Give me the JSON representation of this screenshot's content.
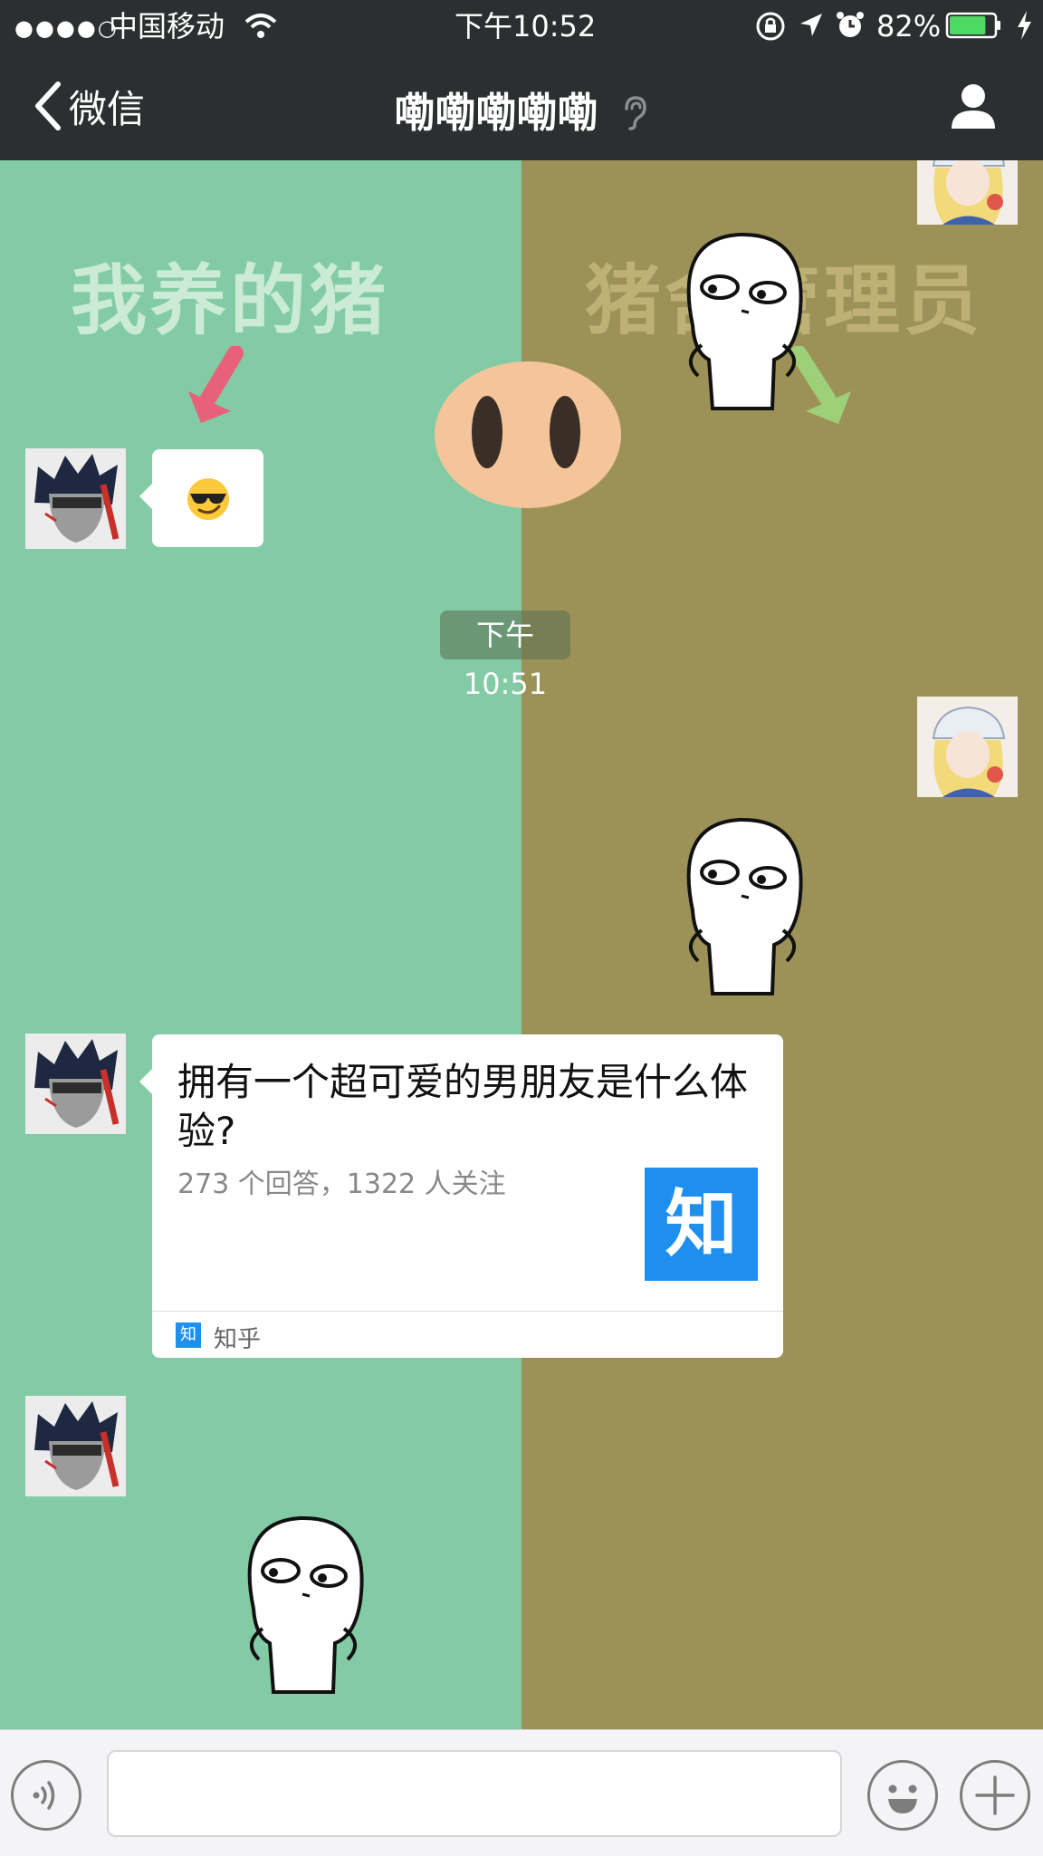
{
  "status_bar": {
    "signal_dots": "●●●●○",
    "carrier": "中国移动",
    "time": "下午10:52",
    "battery_percent": "82%",
    "battery_level": 0.82
  },
  "nav": {
    "back_label": "微信",
    "title": "嘞嘞嘞嘞嘞"
  },
  "background": {
    "left_text": "我养的猪",
    "right_text": "猪舍管理员"
  },
  "messages": {
    "timestamp": "下午10:51",
    "link_card": {
      "title": "拥有一个超可爱的男朋友是什么体验?",
      "description": "273 个回答，1322 人关注",
      "thumb_char": "知",
      "source_icon_char": "知",
      "source": "知乎"
    }
  },
  "input_bar": {
    "placeholder": ""
  },
  "colors": {
    "bar_dark": "#2b2f30",
    "bg_green": "#82cba4",
    "bg_olive": "#9c9258",
    "zhihu_blue": "#1f8fef",
    "battery_green": "#4cd964"
  }
}
